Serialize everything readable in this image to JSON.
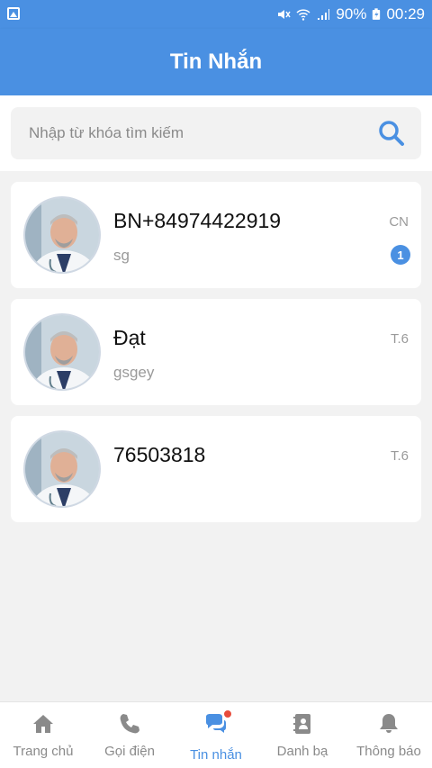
{
  "statusbar": {
    "battery": "90%",
    "time": "00:29"
  },
  "header": {
    "title": "Tin Nhắn"
  },
  "search": {
    "placeholder": "Nhập từ khóa tìm kiếm"
  },
  "conversations": [
    {
      "name": "BN+84974422919",
      "preview": "sg",
      "day": "CN",
      "unread": "1"
    },
    {
      "name": "Đạt",
      "preview": "gsgey",
      "day": "T.6"
    },
    {
      "name": "76503818",
      "preview": "",
      "day": "T.6"
    }
  ],
  "nav": {
    "items": [
      {
        "label": "Trang chủ",
        "icon": "home-icon"
      },
      {
        "label": "Gọi điện",
        "icon": "phone-icon"
      },
      {
        "label": "Tin nhắn",
        "icon": "chat-icon",
        "active": true
      },
      {
        "label": "Danh bạ",
        "icon": "contacts-icon"
      },
      {
        "label": "Thông báo",
        "icon": "bell-icon"
      }
    ]
  },
  "colors": {
    "primary": "#4a90e2",
    "badge": "#4a90e2",
    "notification_dot": "#e74c3c"
  }
}
